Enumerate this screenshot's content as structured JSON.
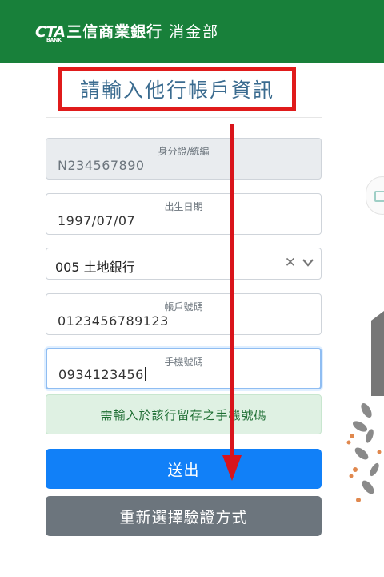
{
  "header": {
    "logo_mark": "CTA",
    "logo_sub": "BANK",
    "bank_name": "三信商業銀行",
    "department": "消金部"
  },
  "form": {
    "title": "請輸入他行帳戶資訊",
    "id_field": {
      "label": "身分證/統編",
      "value": "N234567890"
    },
    "birth_field": {
      "label": "出生日期",
      "value": "1997/07/07"
    },
    "bank_select": {
      "value": "005 土地銀行",
      "clear_icon": "close-icon",
      "dropdown_icon": "chevron-down-icon"
    },
    "account_field": {
      "label": "帳戶號碼",
      "value": "0123456789123"
    },
    "phone_field": {
      "label": "手機號碼",
      "value": "0934123456"
    },
    "notice": "需輸入於該行留存之手機號碼",
    "submit_label": "送出",
    "reselect_label": "重新選擇驗證方式"
  },
  "colors": {
    "header_bg": "#18803a",
    "highlight_border": "#e01b1b",
    "title_text": "#3a6b8f",
    "primary": "#1180f8",
    "secondary": "#6c757d",
    "notice_bg": "#dff1e3"
  }
}
